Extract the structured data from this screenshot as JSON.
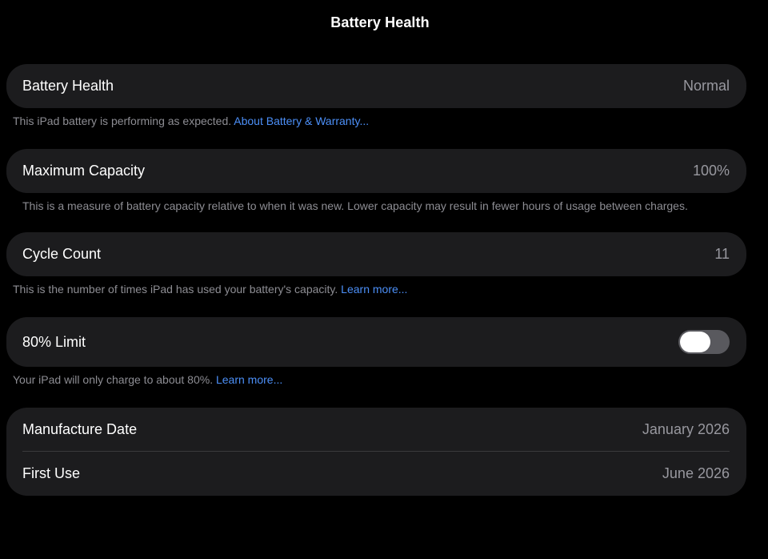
{
  "header": {
    "title": "Battery Health"
  },
  "battery_health": {
    "label": "Battery Health",
    "value": "Normal",
    "footnote_text": "This iPad battery is performing as expected.",
    "footnote_link": "About Battery & Warranty..."
  },
  "maximum_capacity": {
    "label": "Maximum Capacity",
    "value": "100%",
    "footnote_text": "This is a measure of battery capacity relative to when it was new. Lower capacity may result in fewer hours of usage between charges."
  },
  "cycle_count": {
    "label": "Cycle Count",
    "value": "11",
    "footnote_text": "This is the number of times iPad has used your battery's capacity.",
    "footnote_link": "Learn more..."
  },
  "limit_80": {
    "label": "80% Limit",
    "toggle_state": "off",
    "footnote_text": "Your iPad will only charge to about 80%.",
    "footnote_link": "Learn more..."
  },
  "dates": {
    "manufacture_label": "Manufacture Date",
    "manufacture_value": "January 2026",
    "first_use_label": "First Use",
    "first_use_value": "June 2026"
  },
  "colors": {
    "background": "#000000",
    "card": "#1c1c1e",
    "link": "#4c8ff7",
    "secondary_text": "#98989f",
    "toggle_off": "#59595e"
  }
}
